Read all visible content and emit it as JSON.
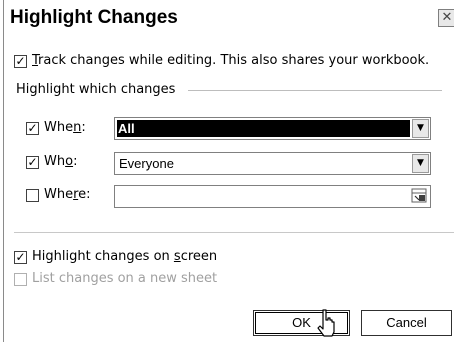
{
  "dialog": {
    "title": "Highlight Changes",
    "close_glyph": "✕"
  },
  "track": {
    "checked": true,
    "prefix": "T",
    "label_rest": "rack changes while editing. This also shares your workbook."
  },
  "group": {
    "label": "Highlight which changes"
  },
  "when": {
    "checked": true,
    "label_pre": "Whe",
    "label_u": "n",
    "label_post": ":",
    "value": "All"
  },
  "who": {
    "checked": true,
    "label_pre": "Wh",
    "label_u": "o",
    "label_post": ":",
    "value": "Everyone"
  },
  "where": {
    "checked": false,
    "label_pre": "Whe",
    "label_u": "r",
    "label_post": "e:",
    "value": ""
  },
  "highlight_screen": {
    "checked": true,
    "label_pre": "Highlight changes on ",
    "label_u": "s",
    "label_post": "creen"
  },
  "list_sheet": {
    "checked": false,
    "enabled": false,
    "label": "List changes on a new sheet"
  },
  "buttons": {
    "ok": "OK",
    "cancel": "Cancel"
  },
  "glyphs": {
    "check": "✓",
    "dropdown": "▼"
  },
  "icons": [
    "close-icon",
    "checkmark-icon",
    "dropdown-arrow-icon",
    "collapse-dialog-icon",
    "mouse-pointer-icon"
  ]
}
